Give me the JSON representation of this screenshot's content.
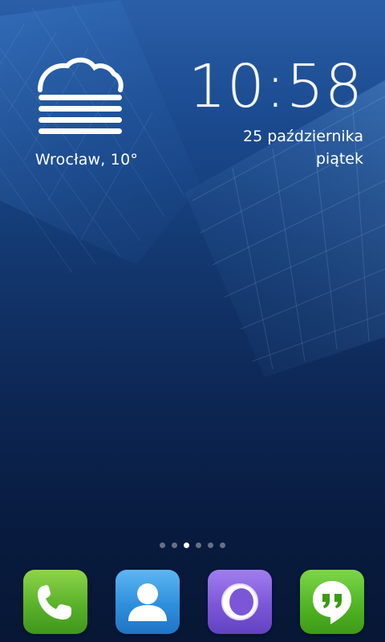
{
  "weather": {
    "icon": "fog-cloud-icon",
    "location": "Wrocław, 10°"
  },
  "clock": {
    "time": "10:58",
    "date": "25 października",
    "day": "piątek"
  },
  "home_pages": {
    "count": 6,
    "active_index": 2
  },
  "dock": {
    "apps": [
      {
        "name": "phone",
        "icon": "phone-handset-icon",
        "color": "#5ab22a"
      },
      {
        "name": "contacts",
        "icon": "person-silhouette-icon",
        "color": "#2f8fdd"
      },
      {
        "name": "browser",
        "icon": "ring-globe-icon",
        "color": "#7b57d8"
      },
      {
        "name": "hangouts",
        "icon": "quote-bubble-icon",
        "color": "#52b526"
      }
    ]
  }
}
